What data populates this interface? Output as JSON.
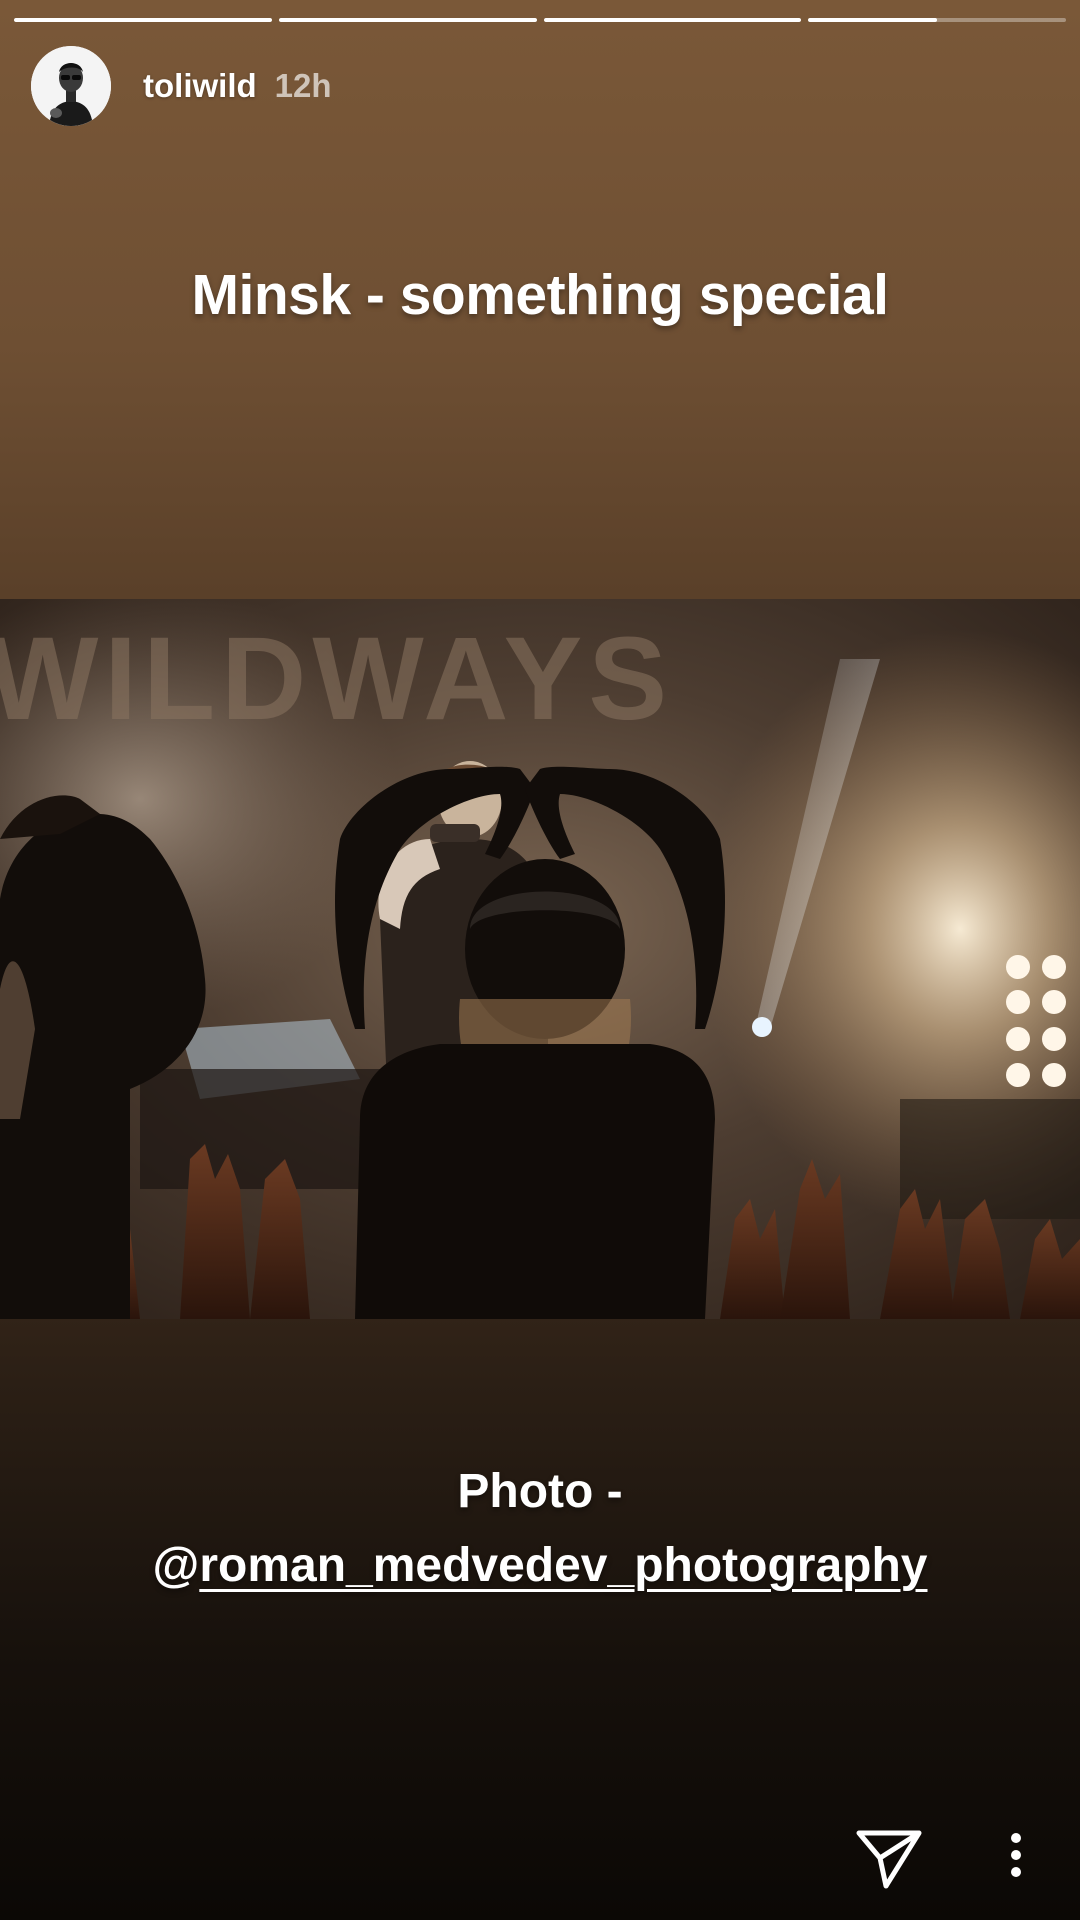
{
  "story": {
    "progress": [
      1,
      1,
      1,
      0.5
    ],
    "user": {
      "username": "toliwild",
      "time_ago": "12h"
    },
    "caption_top": "Minsk - something special",
    "photo": {
      "banner_text": "WILDWAYS"
    },
    "caption_bottom": {
      "line1": "Photo -",
      "at_sign": "@",
      "mention": "roman_medvedev_photography"
    },
    "footer": {
      "send_icon": "paper-plane-icon",
      "more_icon": "vertical-dots-icon"
    }
  }
}
